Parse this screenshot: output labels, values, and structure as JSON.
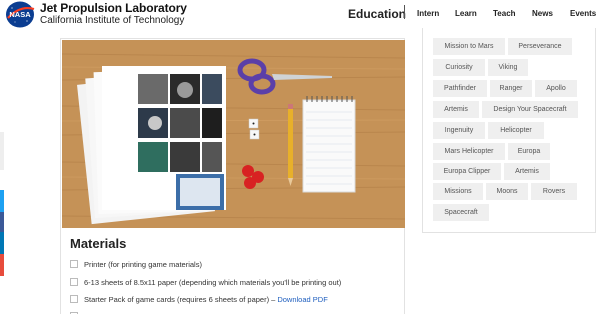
{
  "header": {
    "org_name": "Jet Propulsion Laboratory",
    "org_sub": "California Institute of Technology",
    "logo_text": "NASA",
    "nav_main": "Education",
    "nav_items": [
      "Intern",
      "Learn",
      "Teach",
      "News",
      "Events"
    ]
  },
  "materials": {
    "title": "Materials",
    "items": [
      {
        "text": "Printer (for printing game materials)",
        "link": ""
      },
      {
        "text": "6-13 sheets of 8.5x11 paper (depending which materials you'll be printing out)",
        "link": ""
      },
      {
        "text": "Starter Pack of game cards (requires 6 sheets of paper) –",
        "link": "Download PDF"
      },
      {
        "text": "S",
        "link": ""
      }
    ]
  },
  "tags": [
    "Mission to Mars",
    "Perseverance",
    "Curiosity",
    "Viking",
    "Pathfinder",
    "Ranger",
    "Apollo",
    "Artemis",
    "Design Your Spacecraft",
    "Ingenuity",
    "Helicopter",
    "Mars Helicopter",
    "Europa",
    "Europa Clipper",
    "Artemis",
    "Missions",
    "Moons",
    "Rovers",
    "Spacecraft"
  ],
  "colors": {
    "nasa_blue": "#0b3d91",
    "nasa_red": "#fc3d21",
    "link": "#1f5fbf",
    "tag_bg": "#efefef"
  }
}
